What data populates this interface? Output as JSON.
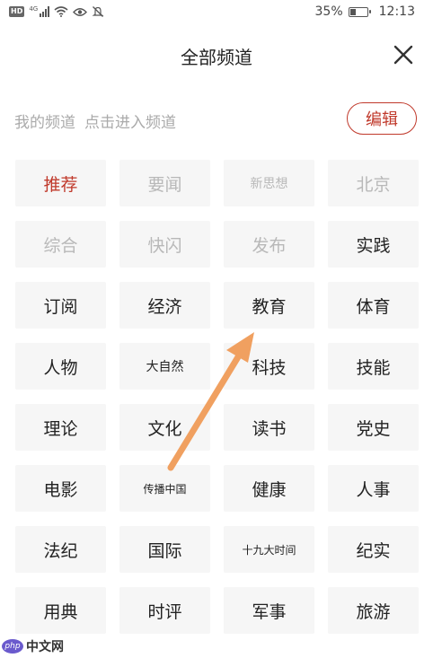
{
  "status_bar": {
    "hd": "HD",
    "signal_label": "4G",
    "battery_percent": "35%",
    "battery_level": 0.35,
    "time": "12:13",
    "icons": [
      "hd-icon",
      "signal-icon",
      "wifi-icon",
      "eye-icon",
      "mute-icon",
      "battery-icon"
    ]
  },
  "header": {
    "title": "全部频道",
    "close_icon": "close-icon"
  },
  "subheader": {
    "my_channels": "我的频道",
    "hint": "点击进入频道",
    "edit_label": "编辑",
    "accent": "#c0392b"
  },
  "channels": [
    {
      "label": "推荐",
      "state": "active"
    },
    {
      "label": "要闻",
      "state": "fixed"
    },
    {
      "label": "新思想",
      "state": "fixed"
    },
    {
      "label": "北京",
      "state": "fixed"
    },
    {
      "label": "综合",
      "state": "fixed"
    },
    {
      "label": "快闪",
      "state": "fixed"
    },
    {
      "label": "发布",
      "state": "fixed"
    },
    {
      "label": "实践",
      "state": "normal"
    },
    {
      "label": "订阅",
      "state": "normal"
    },
    {
      "label": "经济",
      "state": "normal"
    },
    {
      "label": "教育",
      "state": "normal"
    },
    {
      "label": "体育",
      "state": "normal"
    },
    {
      "label": "人物",
      "state": "normal"
    },
    {
      "label": "大自然",
      "state": "normal"
    },
    {
      "label": "科技",
      "state": "normal"
    },
    {
      "label": "技能",
      "state": "normal"
    },
    {
      "label": "理论",
      "state": "normal"
    },
    {
      "label": "文化",
      "state": "normal"
    },
    {
      "label": "读书",
      "state": "normal"
    },
    {
      "label": "党史",
      "state": "normal"
    },
    {
      "label": "电影",
      "state": "normal"
    },
    {
      "label": "传播中国",
      "state": "normal"
    },
    {
      "label": "健康",
      "state": "normal"
    },
    {
      "label": "人事",
      "state": "normal"
    },
    {
      "label": "法纪",
      "state": "normal"
    },
    {
      "label": "国际",
      "state": "normal"
    },
    {
      "label": "十九大时间",
      "state": "normal"
    },
    {
      "label": "纪实",
      "state": "normal"
    },
    {
      "label": "用典",
      "state": "normal"
    },
    {
      "label": "时评",
      "state": "normal"
    },
    {
      "label": "军事",
      "state": "normal"
    },
    {
      "label": "旅游",
      "state": "normal"
    }
  ],
  "annotation": {
    "color": "#f0a060",
    "points_to": "教育"
  },
  "watermark": {
    "logo": "php",
    "text": "中文网"
  }
}
